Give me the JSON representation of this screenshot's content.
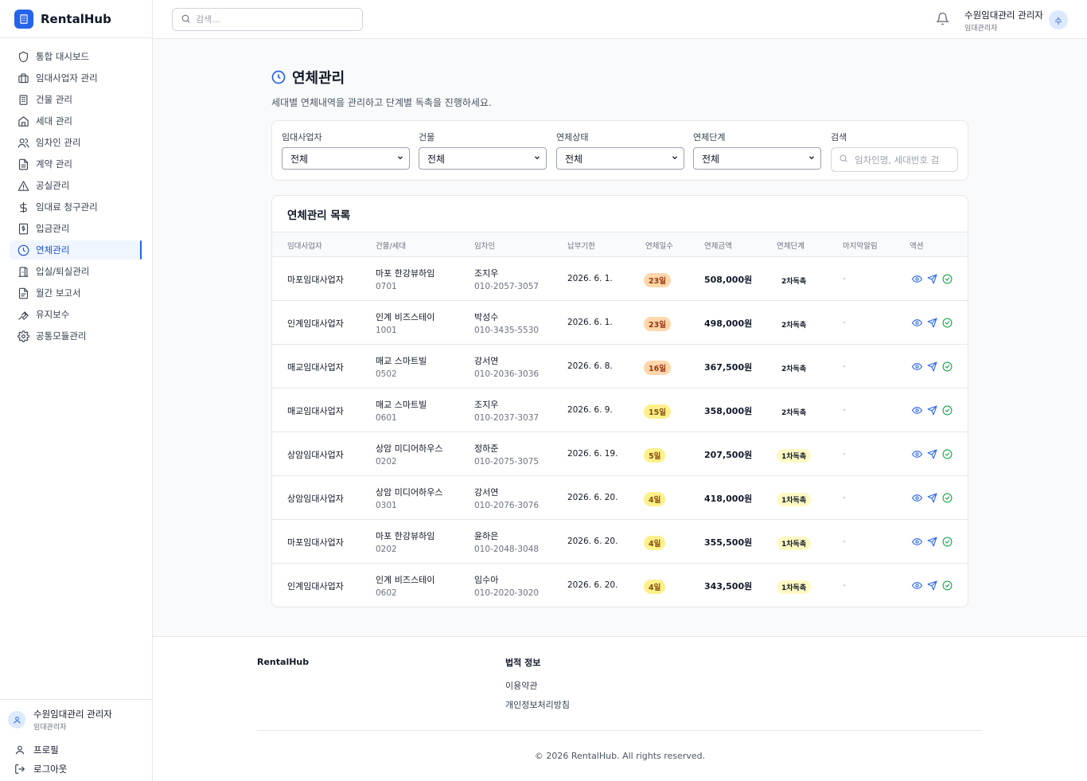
{
  "brand": {
    "name": "RentalHub",
    "accent": "#2563eb"
  },
  "sidebar": {
    "items": [
      {
        "label": "통합 대시보드",
        "icon": "shield-icon"
      },
      {
        "label": "임대사업자 관리",
        "icon": "briefcase-icon"
      },
      {
        "label": "건물 관리",
        "icon": "building-icon"
      },
      {
        "label": "세대 관리",
        "icon": "home-icon"
      },
      {
        "label": "임차인 관리",
        "icon": "users-icon"
      },
      {
        "label": "계약 관리",
        "icon": "document-icon"
      },
      {
        "label": "공실관리",
        "icon": "warning-icon"
      },
      {
        "label": "임대료 청구관리",
        "icon": "dollar-icon"
      },
      {
        "label": "입금관리",
        "icon": "receipt-icon"
      },
      {
        "label": "연체관리",
        "icon": "clock-icon"
      },
      {
        "label": "입실/퇴실관리",
        "icon": "door-icon"
      },
      {
        "label": "월간 보고서",
        "icon": "report-icon"
      },
      {
        "label": "유지보수",
        "icon": "wrench-icon"
      },
      {
        "label": "공통모듈관리",
        "icon": "gear-icon"
      }
    ],
    "active_index": 9,
    "user": {
      "name": "수원임대관리 관리자",
      "role": "임대관리자"
    },
    "profile_label": "프로필",
    "logout_label": "로그아웃"
  },
  "header": {
    "search_placeholder": "검색...",
    "user": {
      "name": "수원임대관리 관리자",
      "role": "임대관리자",
      "avatar_initial": "수"
    }
  },
  "page": {
    "title": "연체관리",
    "description": "세대별 연체내역을 관리하고 단계별 독촉을 진행하세요."
  },
  "filters": {
    "business": {
      "label": "임대사업자",
      "value": "전체"
    },
    "building": {
      "label": "건물",
      "value": "전체"
    },
    "status": {
      "label": "연체상태",
      "value": "전체"
    },
    "stage": {
      "label": "연체단계",
      "value": "전체"
    },
    "search": {
      "label": "검색",
      "placeholder": "임차인명, 세대번호 검"
    }
  },
  "table": {
    "title": "연체관리 목록",
    "columns": [
      "임대사업자",
      "건물/세대",
      "임차인",
      "납부기한",
      "연체일수",
      "연체금액",
      "연체단계",
      "마지막알림",
      "액션"
    ],
    "rows": [
      {
        "business": "마포임대사업자",
        "building": "마포 한강뷰하임",
        "unit": "0701",
        "tenant": "조지우",
        "phone": "010-2057-3057",
        "due": "2026. 6. 1.",
        "days": "23일",
        "days_color": "#fed7aa",
        "days_text": "#9a3412",
        "amount": "508,000원",
        "stage": "2차독촉",
        "stage_bg": "#ffffff",
        "last": "-"
      },
      {
        "business": "인계임대사업자",
        "building": "인계 비즈스테이",
        "unit": "1001",
        "tenant": "박성수",
        "phone": "010-3435-5530",
        "due": "2026. 6. 1.",
        "days": "23일",
        "days_color": "#fed7aa",
        "days_text": "#9a3412",
        "amount": "498,000원",
        "stage": "2차독촉",
        "stage_bg": "#ffffff",
        "last": "-"
      },
      {
        "business": "매교임대사업자",
        "building": "매교 스마트빌",
        "unit": "0502",
        "tenant": "강서연",
        "phone": "010-2036-3036",
        "due": "2026. 6. 8.",
        "days": "16일",
        "days_color": "#fed7aa",
        "days_text": "#9a3412",
        "amount": "367,500원",
        "stage": "2차독촉",
        "stage_bg": "#ffffff",
        "last": "-"
      },
      {
        "business": "매교임대사업자",
        "building": "매교 스마트빌",
        "unit": "0601",
        "tenant": "조지우",
        "phone": "010-2037-3037",
        "due": "2026. 6. 9.",
        "days": "15일",
        "days_color": "#fef08a",
        "days_text": "#854d0e",
        "amount": "358,000원",
        "stage": "2차독촉",
        "stage_bg": "#ffffff",
        "last": "-"
      },
      {
        "business": "상암임대사업자",
        "building": "상암 미디어하우스",
        "unit": "0202",
        "tenant": "정하준",
        "phone": "010-2075-3075",
        "due": "2026. 6. 19.",
        "days": "5일",
        "days_color": "#fef08a",
        "days_text": "#854d0e",
        "amount": "207,500원",
        "stage": "1차독촉",
        "stage_bg": "#fef9c3",
        "last": "-"
      },
      {
        "business": "상암임대사업자",
        "building": "상암 미디어하우스",
        "unit": "0301",
        "tenant": "강서연",
        "phone": "010-2076-3076",
        "due": "2026. 6. 20.",
        "days": "4일",
        "days_color": "#fef08a",
        "days_text": "#854d0e",
        "amount": "418,000원",
        "stage": "1차독촉",
        "stage_bg": "#fef9c3",
        "last": "-"
      },
      {
        "business": "마포임대사업자",
        "building": "마포 한강뷰하임",
        "unit": "0202",
        "tenant": "윤하은",
        "phone": "010-2048-3048",
        "due": "2026. 6. 20.",
        "days": "4일",
        "days_color": "#fef08a",
        "days_text": "#854d0e",
        "amount": "355,500원",
        "stage": "1차독촉",
        "stage_bg": "#fef9c3",
        "last": "-"
      },
      {
        "business": "인계임대사업자",
        "building": "인계 비즈스테이",
        "unit": "0602",
        "tenant": "임수아",
        "phone": "010-2020-3020",
        "due": "2026. 6. 20.",
        "days": "4일",
        "days_color": "#fef08a",
        "days_text": "#854d0e",
        "amount": "343,500원",
        "stage": "1차독촉",
        "stage_bg": "#fef9c3",
        "last": "-"
      }
    ],
    "actions": [
      {
        "icon": "eye-icon",
        "color": "#2563eb"
      },
      {
        "icon": "send-icon",
        "color": "#2563eb"
      },
      {
        "icon": "check-circle-icon",
        "color": "#16a34a"
      }
    ]
  },
  "footer": {
    "brand": "RentalHub",
    "legal_title": "법적 정보",
    "links": [
      "이용약관",
      "개인정보처리방침"
    ],
    "copyright": "© 2026 RentalHub. All rights reserved."
  }
}
